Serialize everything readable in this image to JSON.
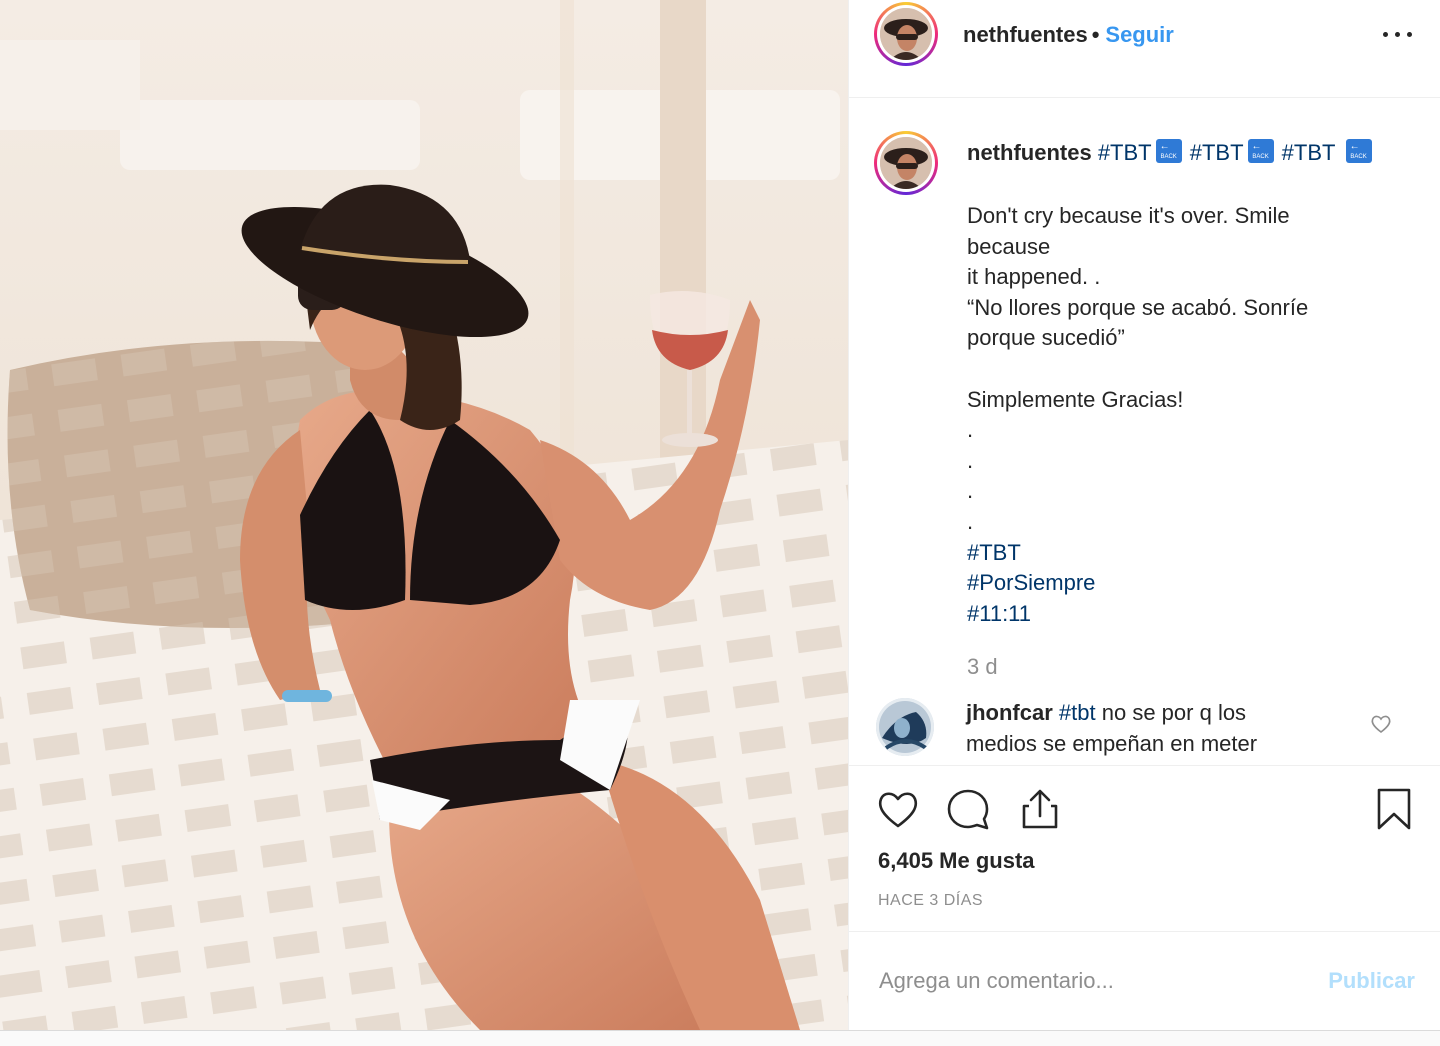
{
  "post": {
    "photo_alt": "",
    "author": {
      "username": "nethfuentes",
      "separator": "•",
      "follow_label": "Seguir"
    },
    "caption": {
      "username": "nethfuentes",
      "hashtags_head": [
        {
          "tag": "#TBT",
          "emoji": "back-arrow-emoji"
        },
        {
          "tag": "#TBT",
          "emoji": "back-arrow-emoji"
        },
        {
          "tag": "#TBT",
          "emoji": "back-arrow-emoji"
        }
      ],
      "emoji_text": "BACK",
      "lines": [
        "Don't cry because it's over. Smile",
        "because",
        "it happened. .",
        "“No llores porque se acabó. Sonríe",
        "porque sucedió”",
        "",
        "Simplemente Gracias!",
        ".",
        ".",
        ".",
        "."
      ],
      "tail_hashtags": [
        "#TBT",
        "#PorSiempre",
        "#11:11"
      ],
      "time_ago": "3 d"
    },
    "comments": [
      {
        "username": "jhonfcar",
        "hashtag": "#tbt",
        "text_line1": "no se por q los",
        "text_line2": "medios se empeñan en meter"
      }
    ],
    "actions": {
      "like_icon": "heart-icon",
      "comment_icon": "comment-icon",
      "share_icon": "share-icon",
      "save_icon": "bookmark-icon"
    },
    "likes_text": "6,405 Me gusta",
    "posted_date": "HACE 3 DÍAS",
    "add_comment": {
      "placeholder": "Agrega un comentario...",
      "publish_label": "Publicar"
    },
    "colors": {
      "link_blue": "#3897f0",
      "hashtag": "#003569",
      "publish_disabled": "#b2dffc",
      "muted": "#8e8e8e"
    }
  }
}
